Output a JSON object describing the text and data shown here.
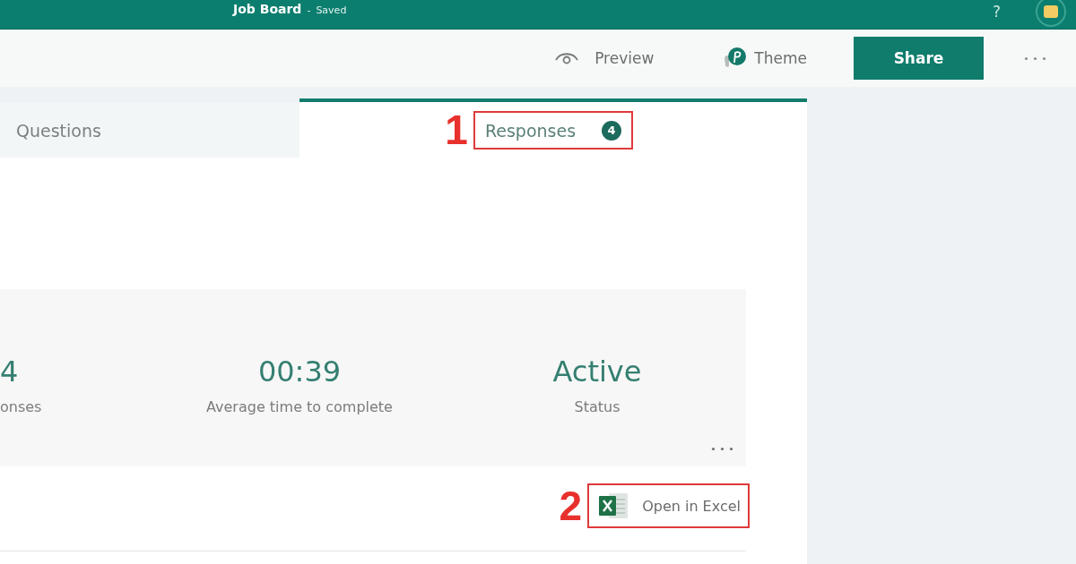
{
  "header": {
    "title": "Job Board",
    "separator": "-",
    "status": "Saved",
    "help": "?"
  },
  "toolbar": [
    {
      "kind": "preview",
      "label": "Preview"
    },
    {
      "kind": "theme",
      "label": "Theme"
    },
    {
      "kind": "share",
      "label": "Share"
    },
    {
      "kind": "more"
    }
  ],
  "tabs": [
    {
      "label": "Questions",
      "selected": false
    },
    {
      "label": "Responses",
      "selected": true,
      "count": "4",
      "annotation": "1"
    }
  ],
  "summary": {
    "stats": [
      {
        "value": "4",
        "label": "onses"
      },
      {
        "value": "00:39",
        "label": "Average time to complete"
      },
      {
        "value": "Active",
        "label": "Status"
      }
    ]
  },
  "open_in_excel": {
    "label": "Open in Excel",
    "annotation": "2"
  }
}
